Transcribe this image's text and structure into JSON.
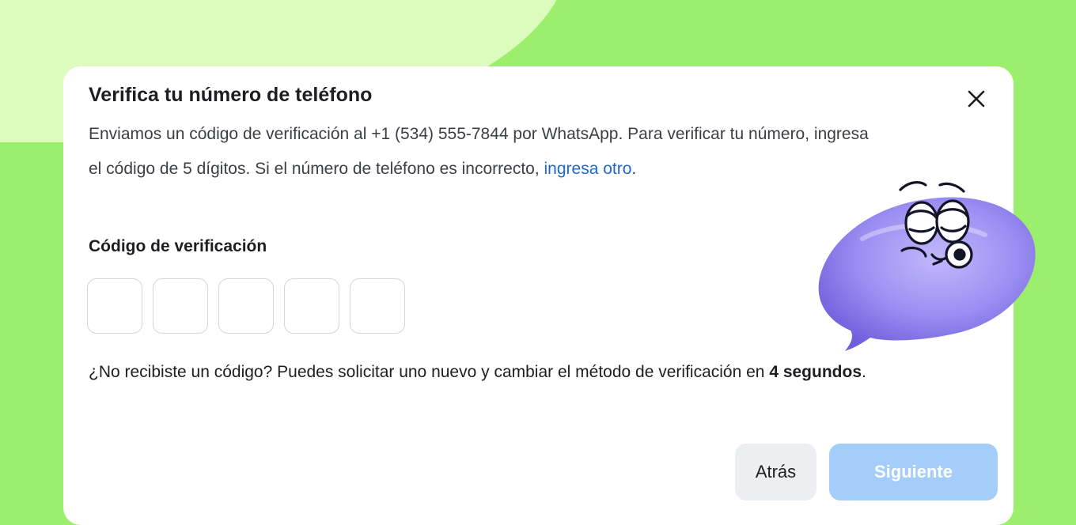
{
  "dialog": {
    "title": "Verifica tu número de teléfono",
    "description_before_link": "Enviamos un código de verificación al +1 (534) 555-7844 por WhatsApp. Para verificar tu número, ingresa el código de 5 dígitos. Si el número de teléfono es incorrecto, ",
    "description_link": "ingresa otro",
    "description_after_link": ".",
    "code_label": "Código de verificación",
    "code_digits": [
      "",
      "",
      "",
      "",
      ""
    ],
    "resend_text_before": "¿No recibiste un código? Puedes solicitar uno nuevo y cambiar el método de verificación en ",
    "resend_countdown": "4 segundos",
    "resend_text_after": ".",
    "back_button": "Atrás",
    "next_button": "Siguiente",
    "close_icon": "close-icon"
  },
  "colors": {
    "background": "#9cef6d",
    "background_shape": "#dcfcbe",
    "link": "#1e66d8",
    "next_button_disabled": "#a5cdfa",
    "back_button": "#eceef1",
    "mascot": "#9c8cf2"
  },
  "decoration": {
    "mascot_icon": "speech-bubble-character-icon"
  }
}
